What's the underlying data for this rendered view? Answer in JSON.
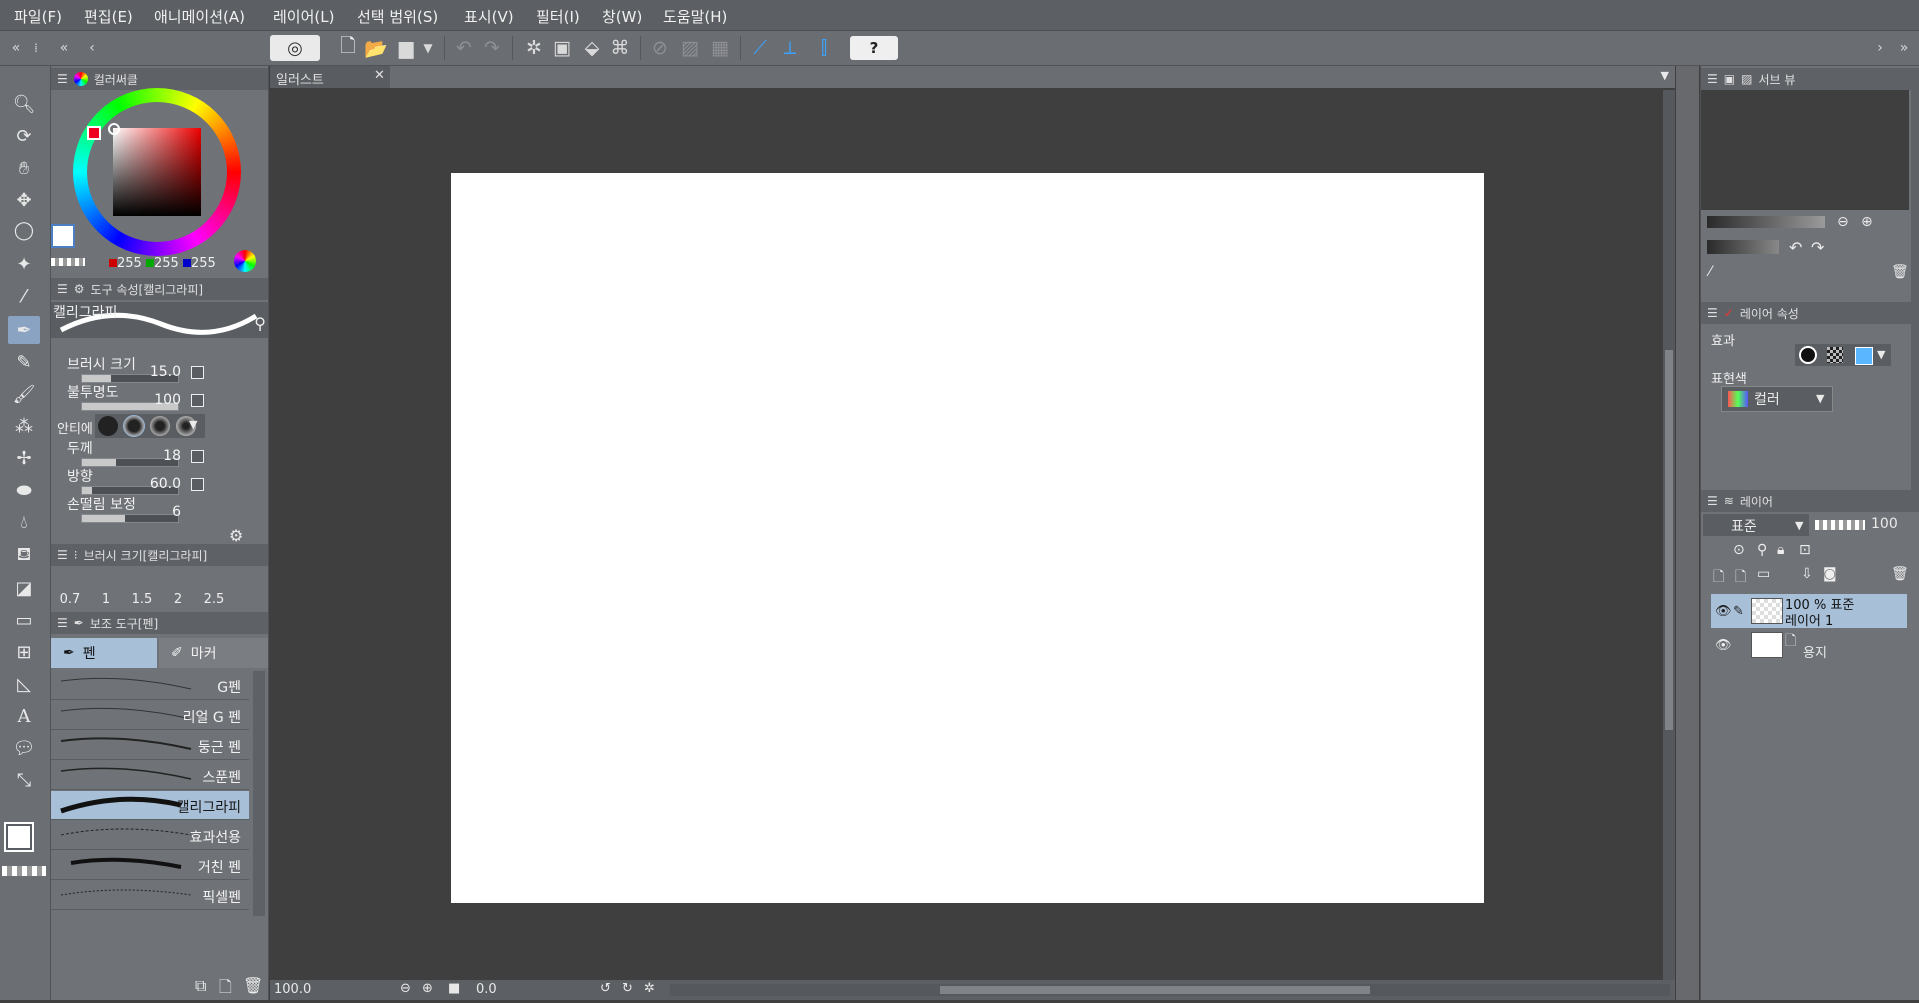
{
  "menu": [
    "파일(F)",
    "편집(E)",
    "애니메이션(A)",
    "레이어(L)",
    "선택 범위(S)",
    "표시(V)",
    "필터(I)",
    "창(W)",
    "도움말(H)"
  ],
  "color_panel": {
    "tab": "컬러써클",
    "r": "255",
    "g": "255",
    "b": "255"
  },
  "tool_property": {
    "tab": "도구 속성[캘리그라피]",
    "preview_label": "캘리그라피",
    "rows": [
      {
        "label": "브러시 크기",
        "value": "15.0",
        "fill": 0.3
      },
      {
        "label": "불투명도",
        "value": "100",
        "fill": 1.0
      },
      {
        "label": "안티에",
        "value": ""
      },
      {
        "label": "두께",
        "value": "18",
        "fill": 0.35
      },
      {
        "label": "방향",
        "value": "60.0",
        "fill": 0.1
      },
      {
        "label": "손떨림 보정",
        "value": "6",
        "fill": 0.45
      }
    ]
  },
  "brush_size": {
    "tab": "브러시 크기[캘리그라피]",
    "sizes": [
      "0.7",
      "1",
      "1.5",
      "2",
      "2.5"
    ]
  },
  "sub_tool": {
    "tab": "보조 도구[펜]",
    "groups": [
      "펜",
      "마커"
    ],
    "items": [
      "G펜",
      "리얼 G 펜",
      "둥근 펜",
      "스푼펜",
      "캘리그라피",
      "효과선용",
      "거친 펜",
      "픽셀펜"
    ],
    "selected_index": 4
  },
  "document": {
    "tab": "일러스트"
  },
  "status": {
    "zoom": "100.0",
    "rotation": "0.0"
  },
  "navigator": {
    "tab": "서브 뷰"
  },
  "layer_property": {
    "tab": "레이어 속성",
    "effect_label": "효과",
    "expr_label": "표현색",
    "expr_value": "컬러"
  },
  "layers": {
    "tab": "레이어",
    "blend": "표준",
    "opacity": "100",
    "items": [
      {
        "line1": "100 % 표준",
        "line2": "레이어 1"
      },
      {
        "line1": "",
        "line2": "용지"
      }
    ]
  },
  "colors": {
    "accent": "#3aa3ff",
    "selection": "#a8bfd8",
    "panel": "#6f7277",
    "canvas_bg": "#3f3f3f"
  }
}
